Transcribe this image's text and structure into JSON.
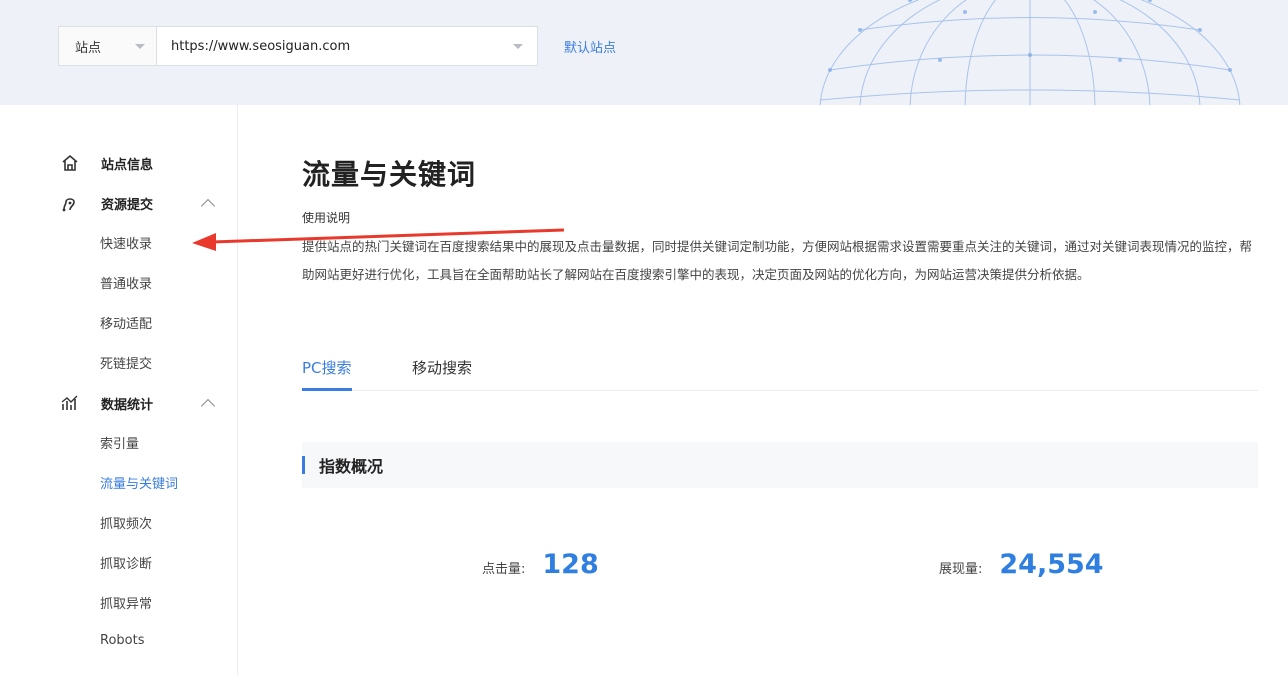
{
  "header": {
    "site_type": "站点",
    "site_url": "https://www.seosiguan.com",
    "default_site": "默认站点"
  },
  "sidebar": {
    "groups": [
      {
        "label": "站点信息",
        "icon": "home-icon"
      },
      {
        "label": "资源提交",
        "icon": "submit-icon",
        "items": [
          "快速收录",
          "普通收录",
          "移动适配",
          "死链提交"
        ]
      },
      {
        "label": "数据统计",
        "icon": "stats-icon",
        "items": [
          "索引量",
          "流量与关键词",
          "抓取频次",
          "抓取诊断",
          "抓取异常",
          "Robots"
        ]
      }
    ],
    "active_item": "流量与关键词"
  },
  "main": {
    "title": "流量与关键词",
    "usage_label": "使用说明",
    "description": "提供站点的热门关键词在百度搜索结果中的展现及点击量数据，同时提供关键词定制功能，方便网站根据需求设置需要重点关注的关键词，通过对关键词表现情况的监控，帮助网站更好进行优化，工具旨在全面帮助站长了解网站在百度搜索引擎中的表现，决定页面及网站的优化方向，为网站运营决策提供分析依据。",
    "tabs": [
      "PC搜索",
      "移动搜索"
    ],
    "active_tab": "PC搜索",
    "section_title": "指数概况",
    "stats": {
      "clicks_label": "点击量:",
      "clicks_value": "128",
      "impressions_label": "展现量:",
      "impressions_value": "24,554"
    }
  },
  "colors": {
    "accent": "#3a7de0",
    "annotation_arrow": "#e8392c"
  }
}
